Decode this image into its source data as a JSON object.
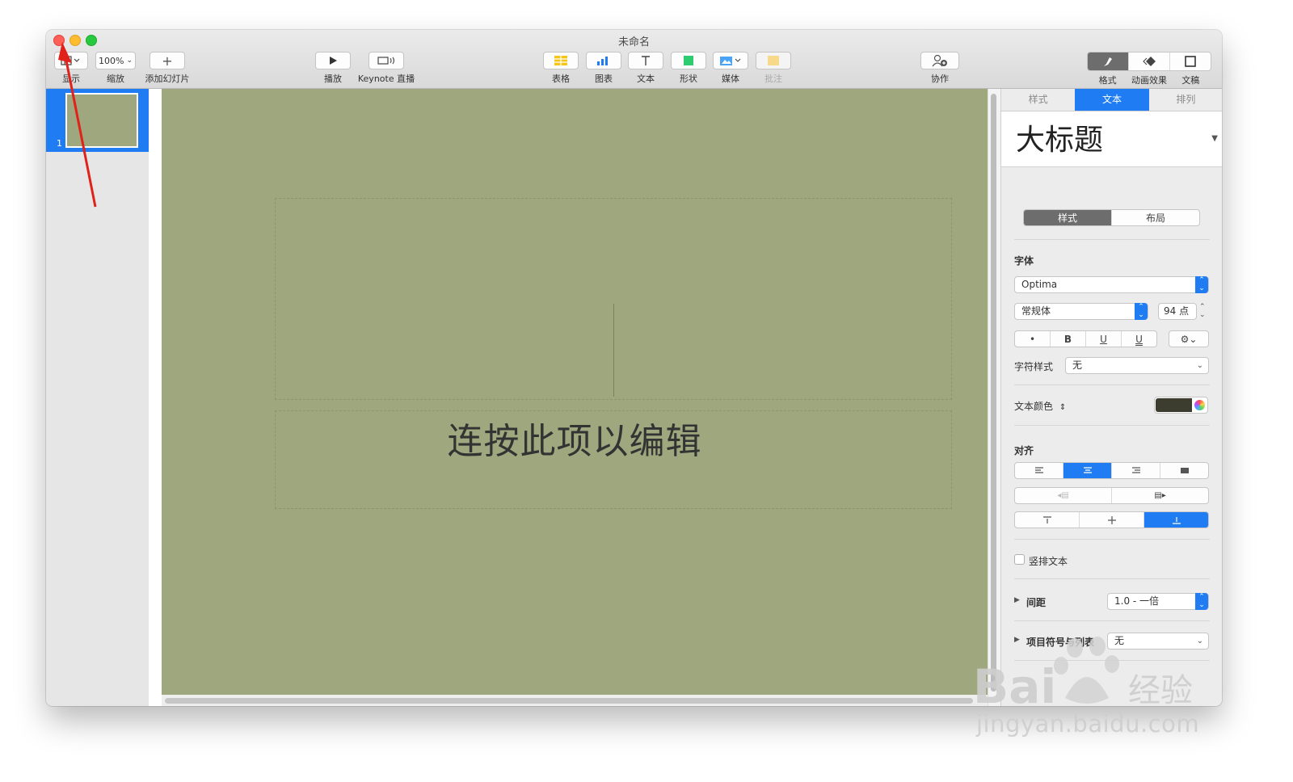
{
  "window": {
    "title": "未命名"
  },
  "toolbar": {
    "view_label": "显示",
    "zoom_value": "100%",
    "zoom_label": "缩放",
    "add_slide_label": "添加幻灯片",
    "play_label": "播放",
    "keynote_live_label": "Keynote 直播",
    "table_label": "表格",
    "chart_label": "图表",
    "text_label": "文本",
    "shape_label": "形状",
    "media_label": "媒体",
    "comment_label": "批注",
    "collaborate_label": "协作",
    "format_label": "格式",
    "animate_label": "动画效果",
    "document_label": "文稿"
  },
  "navigator": {
    "slides": [
      {
        "number": "1"
      }
    ]
  },
  "slide": {
    "placeholder_text": "连按此项以编辑",
    "background_color": "#9ea77d"
  },
  "inspector": {
    "tabs": [
      "样式",
      "文本",
      "排列"
    ],
    "active_tab": "文本",
    "paragraph_style": "大标题",
    "segments": [
      "样式",
      "布局"
    ],
    "font_section": "字体",
    "font_name": "Optima",
    "font_weight": "常规体",
    "font_size": "94 点",
    "style_buttons": [
      "•",
      "B",
      "U",
      "U"
    ],
    "char_style_label": "字符样式",
    "char_style_value": "无",
    "text_color_label": "文本颜色",
    "text_color": "#3c3d2e",
    "align_section": "对齐",
    "vertical_text_label": "竖排文本",
    "spacing_label": "间距",
    "spacing_value": "1.0 - 一倍",
    "bullets_label": "项目符号与列表",
    "bullets_value": "无"
  },
  "colors": {
    "accent": "#1f7cf2",
    "annotation_arrow": "#e0221b"
  },
  "watermark": {
    "brand": "Bai du 经验",
    "url": "jingyan.baidu.com"
  }
}
